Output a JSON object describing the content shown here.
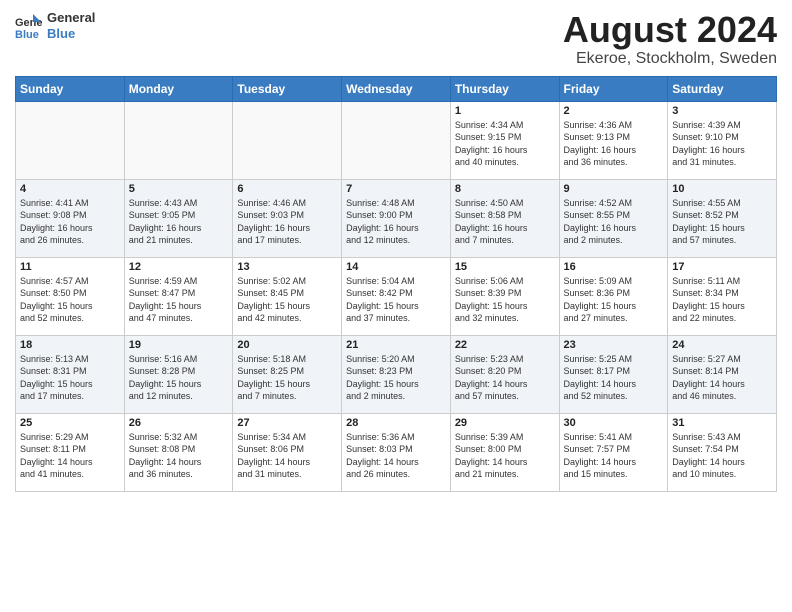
{
  "header": {
    "logo_line1": "General",
    "logo_line2": "Blue",
    "month_year": "August 2024",
    "location": "Ekeroe, Stockholm, Sweden"
  },
  "days_of_week": [
    "Sunday",
    "Monday",
    "Tuesday",
    "Wednesday",
    "Thursday",
    "Friday",
    "Saturday"
  ],
  "weeks": [
    [
      {
        "day": "",
        "info": ""
      },
      {
        "day": "",
        "info": ""
      },
      {
        "day": "",
        "info": ""
      },
      {
        "day": "",
        "info": ""
      },
      {
        "day": "1",
        "info": "Sunrise: 4:34 AM\nSunset: 9:15 PM\nDaylight: 16 hours\nand 40 minutes."
      },
      {
        "day": "2",
        "info": "Sunrise: 4:36 AM\nSunset: 9:13 PM\nDaylight: 16 hours\nand 36 minutes."
      },
      {
        "day": "3",
        "info": "Sunrise: 4:39 AM\nSunset: 9:10 PM\nDaylight: 16 hours\nand 31 minutes."
      }
    ],
    [
      {
        "day": "4",
        "info": "Sunrise: 4:41 AM\nSunset: 9:08 PM\nDaylight: 16 hours\nand 26 minutes."
      },
      {
        "day": "5",
        "info": "Sunrise: 4:43 AM\nSunset: 9:05 PM\nDaylight: 16 hours\nand 21 minutes."
      },
      {
        "day": "6",
        "info": "Sunrise: 4:46 AM\nSunset: 9:03 PM\nDaylight: 16 hours\nand 17 minutes."
      },
      {
        "day": "7",
        "info": "Sunrise: 4:48 AM\nSunset: 9:00 PM\nDaylight: 16 hours\nand 12 minutes."
      },
      {
        "day": "8",
        "info": "Sunrise: 4:50 AM\nSunset: 8:58 PM\nDaylight: 16 hours\nand 7 minutes."
      },
      {
        "day": "9",
        "info": "Sunrise: 4:52 AM\nSunset: 8:55 PM\nDaylight: 16 hours\nand 2 minutes."
      },
      {
        "day": "10",
        "info": "Sunrise: 4:55 AM\nSunset: 8:52 PM\nDaylight: 15 hours\nand 57 minutes."
      }
    ],
    [
      {
        "day": "11",
        "info": "Sunrise: 4:57 AM\nSunset: 8:50 PM\nDaylight: 15 hours\nand 52 minutes."
      },
      {
        "day": "12",
        "info": "Sunrise: 4:59 AM\nSunset: 8:47 PM\nDaylight: 15 hours\nand 47 minutes."
      },
      {
        "day": "13",
        "info": "Sunrise: 5:02 AM\nSunset: 8:45 PM\nDaylight: 15 hours\nand 42 minutes."
      },
      {
        "day": "14",
        "info": "Sunrise: 5:04 AM\nSunset: 8:42 PM\nDaylight: 15 hours\nand 37 minutes."
      },
      {
        "day": "15",
        "info": "Sunrise: 5:06 AM\nSunset: 8:39 PM\nDaylight: 15 hours\nand 32 minutes."
      },
      {
        "day": "16",
        "info": "Sunrise: 5:09 AM\nSunset: 8:36 PM\nDaylight: 15 hours\nand 27 minutes."
      },
      {
        "day": "17",
        "info": "Sunrise: 5:11 AM\nSunset: 8:34 PM\nDaylight: 15 hours\nand 22 minutes."
      }
    ],
    [
      {
        "day": "18",
        "info": "Sunrise: 5:13 AM\nSunset: 8:31 PM\nDaylight: 15 hours\nand 17 minutes."
      },
      {
        "day": "19",
        "info": "Sunrise: 5:16 AM\nSunset: 8:28 PM\nDaylight: 15 hours\nand 12 minutes."
      },
      {
        "day": "20",
        "info": "Sunrise: 5:18 AM\nSunset: 8:25 PM\nDaylight: 15 hours\nand 7 minutes."
      },
      {
        "day": "21",
        "info": "Sunrise: 5:20 AM\nSunset: 8:23 PM\nDaylight: 15 hours\nand 2 minutes."
      },
      {
        "day": "22",
        "info": "Sunrise: 5:23 AM\nSunset: 8:20 PM\nDaylight: 14 hours\nand 57 minutes."
      },
      {
        "day": "23",
        "info": "Sunrise: 5:25 AM\nSunset: 8:17 PM\nDaylight: 14 hours\nand 52 minutes."
      },
      {
        "day": "24",
        "info": "Sunrise: 5:27 AM\nSunset: 8:14 PM\nDaylight: 14 hours\nand 46 minutes."
      }
    ],
    [
      {
        "day": "25",
        "info": "Sunrise: 5:29 AM\nSunset: 8:11 PM\nDaylight: 14 hours\nand 41 minutes."
      },
      {
        "day": "26",
        "info": "Sunrise: 5:32 AM\nSunset: 8:08 PM\nDaylight: 14 hours\nand 36 minutes."
      },
      {
        "day": "27",
        "info": "Sunrise: 5:34 AM\nSunset: 8:06 PM\nDaylight: 14 hours\nand 31 minutes."
      },
      {
        "day": "28",
        "info": "Sunrise: 5:36 AM\nSunset: 8:03 PM\nDaylight: 14 hours\nand 26 minutes."
      },
      {
        "day": "29",
        "info": "Sunrise: 5:39 AM\nSunset: 8:00 PM\nDaylight: 14 hours\nand 21 minutes."
      },
      {
        "day": "30",
        "info": "Sunrise: 5:41 AM\nSunset: 7:57 PM\nDaylight: 14 hours\nand 15 minutes."
      },
      {
        "day": "31",
        "info": "Sunrise: 5:43 AM\nSunset: 7:54 PM\nDaylight: 14 hours\nand 10 minutes."
      }
    ]
  ]
}
